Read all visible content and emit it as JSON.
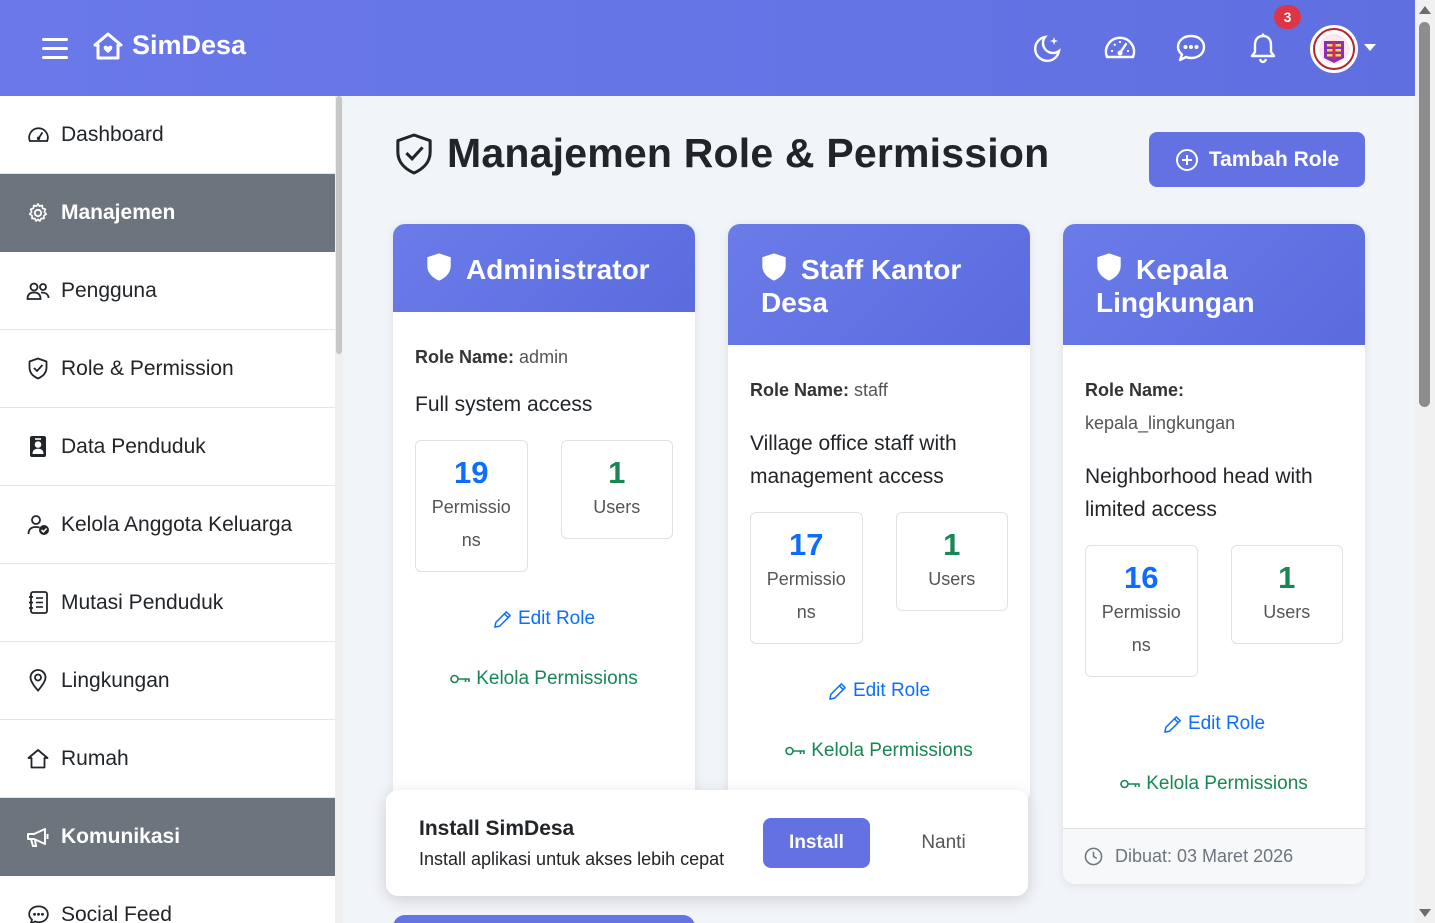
{
  "navbar": {
    "brand": "SimDesa",
    "notification_count": "3",
    "icons": [
      "theme-toggle-icon",
      "speedometer-icon",
      "chat-icon",
      "bell-icon"
    ]
  },
  "sidebar": {
    "items": [
      {
        "label": "Dashboard",
        "icon": "speedometer-icon",
        "type": "item"
      },
      {
        "label": "Manajemen",
        "icon": "gear-icon",
        "type": "header"
      },
      {
        "label": "Pengguna",
        "icon": "people-icon",
        "type": "item"
      },
      {
        "label": "Role & Permission",
        "icon": "shield-check-icon",
        "type": "item"
      },
      {
        "label": "Data Penduduk",
        "icon": "person-badge-icon",
        "type": "item"
      },
      {
        "label": "Kelola Anggota Keluarga",
        "icon": "person-check-icon",
        "type": "item"
      },
      {
        "label": "Mutasi Penduduk",
        "icon": "journal-icon",
        "type": "item"
      },
      {
        "label": "Lingkungan",
        "icon": "geo-pin-icon",
        "type": "item"
      },
      {
        "label": "Rumah",
        "icon": "house-icon",
        "type": "item"
      },
      {
        "label": "Komunikasi",
        "icon": "megaphone-icon",
        "type": "header"
      },
      {
        "label": "Social Feed",
        "icon": "chat-dots-icon",
        "type": "item"
      }
    ]
  },
  "main": {
    "title": "Manajemen Role & Permission",
    "add_button": "Tambah Role",
    "role_name_label": "Role Name:",
    "permissions_label": "Permissions",
    "users_label": "Users",
    "edit_label": "Edit Role",
    "manage_label": "Kelola Permissions",
    "roles": [
      {
        "title": "Administrator",
        "role_name": "admin",
        "description": "Full system access",
        "permissions": "19",
        "users": "1"
      },
      {
        "title": "Staff Kantor Desa",
        "role_name": "staff",
        "description": "Village office staff with management access",
        "permissions": "17",
        "users": "1"
      },
      {
        "title": "Kepala Lingkungan",
        "role_name": "kepala_lingkungan",
        "description": "Neighborhood head with limited access",
        "permissions": "16",
        "users": "1",
        "created": "Dibuat: 03 Maret 2026"
      }
    ]
  },
  "install_prompt": {
    "title": "Install SimDesa",
    "subtitle": "Install aplikasi untuk akses lebih cepat",
    "install_button": "Install",
    "later_button": "Nanti"
  },
  "colors": {
    "primary": "#6371e3",
    "header_gradient_start": "#6a78e8",
    "sidebar_header": "#6c757d",
    "blue": "#0d6efd",
    "green": "#198754",
    "badge": "#dc3545"
  }
}
